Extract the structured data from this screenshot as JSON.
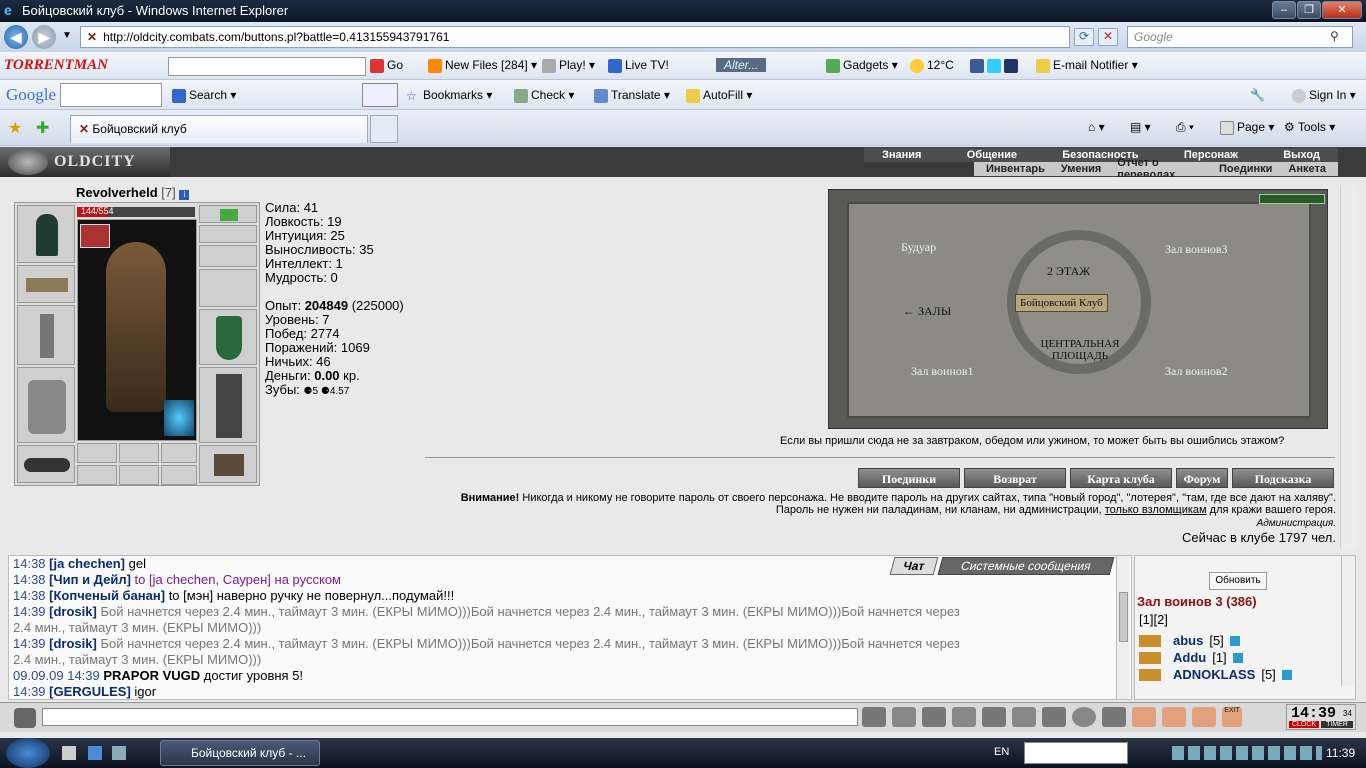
{
  "window": {
    "title": "Бойцовский клуб - Windows Internet Explorer"
  },
  "address": {
    "url": "http://oldcity.combats.com/buttons.pl?battle=0.413155943791761",
    "search_placeholder": "Google"
  },
  "toolbar1": {
    "brand": "TORRENTMAN",
    "go": "Go",
    "newfiles": "New Files [284]",
    "play": "Play!",
    "livetv": "Live TV!",
    "alter": "Alter...",
    "gadgets": "Gadgets",
    "temp": "12°C",
    "email": "E-mail Notifier"
  },
  "toolbar2": {
    "google": "Google",
    "search": "Search",
    "bookmarks": "Bookmarks",
    "check": "Check",
    "translate": "Translate",
    "autofill": "AutoFill",
    "signin": "Sign In"
  },
  "toolbar3": {
    "tab_title": "Бойцовский клуб",
    "page": "Page",
    "tools": "Tools"
  },
  "game": {
    "logo": "OLDCITY",
    "menu_top": [
      "Знания",
      "Общение",
      "Безопасность",
      "Персонаж",
      "Выход"
    ],
    "menu_sub": [
      "Инвентарь",
      "Умения",
      "Отчет о переводах",
      "Поединки",
      "Анкета"
    ],
    "character": {
      "name": "Revolverheld",
      "level": "[7]",
      "hp": "144/554",
      "hp_fraction": 0.26
    },
    "stats": [
      {
        "label": "Сила:",
        "value": "41"
      },
      {
        "label": "Ловкость:",
        "value": "19"
      },
      {
        "label": "Интуиция:",
        "value": "25"
      },
      {
        "label": "Выносливость:",
        "value": "35"
      },
      {
        "label": "Интеллект:",
        "value": "1"
      },
      {
        "label": "Мудрость:",
        "value": "0"
      }
    ],
    "exp": {
      "label": "Опыт:",
      "value": "204849",
      "next": "(225000)"
    },
    "info": [
      "Уровень: 7",
      "Побед: 2774",
      "Поражений: 1069",
      "Ничьих: 46"
    ],
    "money": {
      "label": "Деньги:",
      "value": "0.00",
      "unit": "кр."
    },
    "teeth": {
      "label": "Зубы:",
      "v1": "5",
      "v2": "4.57"
    },
    "map": {
      "rooms": [
        "Будуар",
        "Зал воинов3",
        "2 ЭТАЖ",
        "Бойцовский Клуб",
        "ЗАЛЫ",
        "ЦЕНТРАЛЬНАЯ ПЛОЩАДЬ",
        "Зал воинов1",
        "Зал воинов2"
      ]
    },
    "map_note": "Если вы пришли сюда не за завтраком, обедом или ужином, то может быть вы ошиблись этажом?",
    "buttons": [
      "Поединки",
      "Возврат",
      "Карта клуба",
      "Форум",
      "Подсказка"
    ],
    "warning_bold": "Внимание!",
    "warning_text": "Никогда и никому не говорите пароль от своего персонажа. Не вводите пароль на других сайтах, типа \"новый город\", \"лотерея\", \"там, где все дают на халяву\". Пароль не нужен ни паладинам, ни кланам, ни администрации,",
    "warning_link": "только взломщикам",
    "warning_tail": "для кражи вашего героя.",
    "admin": "Администрация.",
    "online_count": "Сейчас в клубе 1797 чел."
  },
  "chat": {
    "tabs": [
      "Чат",
      "Системные сообщения"
    ],
    "lines": [
      {
        "time": "14:38",
        "nick": "[ja chechen]",
        "text": "gel"
      },
      {
        "time": "14:38",
        "nick": "[Чип и Дейл]",
        "text": "to [ja chechen, Саурен] на русском",
        "style": "purple"
      },
      {
        "time": "14:38",
        "nick": "[Копченый банан]",
        "text": "to [мэн] наверно ручку не повернул...подумай!!!"
      },
      {
        "time": "14:39",
        "nick": "[drosik]",
        "text": "Бой начнется через 2.4 мин., таймаут 3 мин. (ЕКРЫ МИМО)))Бой начнется через 2.4 мин., таймаут 3 мин. (ЕКРЫ МИМО)))Бой начнется через",
        "cont": "2.4 мин., таймаут 3 мин. (ЕКРЫ МИМО)))",
        "style": "sys"
      },
      {
        "time": "14:39",
        "nick": "[drosik]",
        "text": "Бой начнется через 2.4 мин., таймаут 3 мин. (ЕКРЫ МИМО)))Бой начнется через 2.4 мин., таймаут 3 мин. (ЕКРЫ МИМО)))Бой начнется через",
        "cont": "2.4 мин., таймаут 3 мин. (ЕКРЫ МИМО)))",
        "style": "sys"
      },
      {
        "time": "09.09.09 14:39",
        "nick": "PRAPOR VUGD",
        "text": "достиг уровня 5!",
        "style": "plain"
      },
      {
        "time": "14:39",
        "nick": "[GERGULES]",
        "text": "igor"
      }
    ]
  },
  "room": {
    "refresh": "Обновить",
    "title": "Зал воинов 3 (386)",
    "pages": "[1][2]",
    "players": [
      {
        "name": "abus",
        "level": "[5]"
      },
      {
        "name": "Addu",
        "level": "[1]"
      },
      {
        "name": "ADNOKLASS",
        "level": "[5]"
      }
    ]
  },
  "clock": {
    "time": "14:39",
    "sec": "34",
    "clock_label": "CLOCK",
    "timer_label": "TIMER",
    "exit": "EXIT"
  },
  "taskbar": {
    "task": "Бойцовский клуб - ...",
    "lang": "EN",
    "time": "11:39"
  }
}
